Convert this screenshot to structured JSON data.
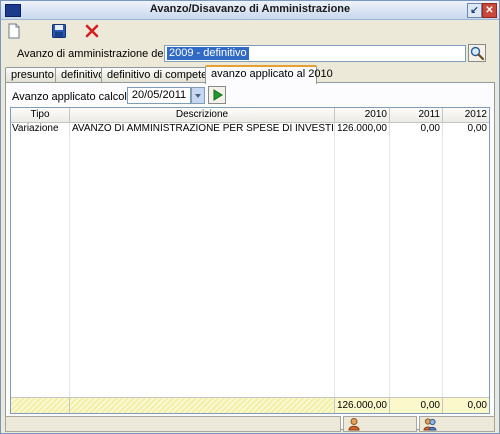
{
  "window": {
    "title": "Avanzo/Disavanzo di Amministrazione"
  },
  "toolbar": {
    "icons": [
      "new-document-icon",
      "save-icon",
      "delete-icon"
    ]
  },
  "esercizio": {
    "label": "Avanzo di amministrazione dell'esercizio:",
    "value": "2009 - definitivo"
  },
  "tabs": [
    {
      "label": "presunto"
    },
    {
      "label": "definitivo"
    },
    {
      "label": "definitivo di competenza"
    },
    {
      "label": "avanzo applicato al 2010"
    }
  ],
  "calc": {
    "label": "Avanzo applicato calcolato al:",
    "date": "20/05/2011"
  },
  "grid": {
    "columns": [
      "Tipo",
      "Descrizione",
      "2010",
      "2011",
      "2012"
    ],
    "rows": [
      {
        "tipo": "Variazione",
        "descrizione": "AVANZO DI AMMINISTRAZIONE PER SPESE DI INVESTIMENTO",
        "y2010": "126.000,00",
        "y2011": "0,00",
        "y2012": "0,00"
      }
    ],
    "totals": {
      "y2010": "126.000,00",
      "y2011": "0,00",
      "y2012": "0,00"
    }
  },
  "colors": {
    "accent": "#316ac5",
    "active_tab": "#e89f31",
    "total_row": "#fbf8cc"
  }
}
